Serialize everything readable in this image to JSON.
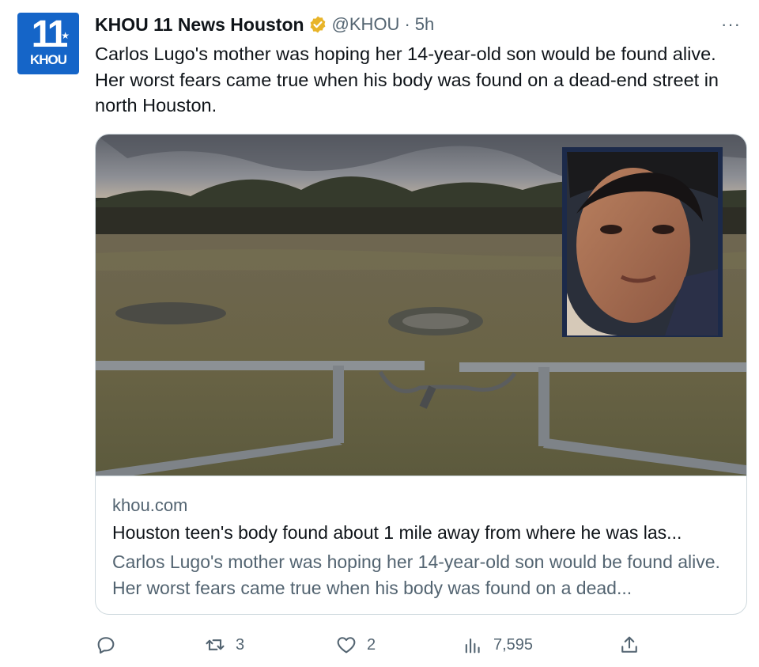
{
  "account": {
    "avatar_number": "11",
    "avatar_brand": "KHOU",
    "display_name": "KHOU 11 News Houston",
    "handle": "@KHOU",
    "separator": "·",
    "time": "5h",
    "more_label": "···",
    "verified_badge_icon": "gold-verified-badge-icon"
  },
  "tweet": {
    "text": "Carlos Lugo's mother was hoping her 14-year-old son would be found alive. Her worst fears came true when his body was found on a dead-end street in north Houston."
  },
  "card": {
    "domain": "khou.com",
    "title": "Houston teen's body found about 1 mile away from where he was las...",
    "description": "Carlos Lugo's mother was hoping her 14-year-old son would be found alive. Her worst fears came true when his body was found on a dead..."
  },
  "actions": {
    "reply_icon": "reply-icon",
    "retweet_icon": "retweet-icon",
    "retweet_count": "3",
    "like_icon": "heart-icon",
    "like_count": "2",
    "views_icon": "views-icon",
    "views_count": "7,595",
    "share_icon": "share-icon"
  },
  "colors": {
    "text_primary": "#0f1419",
    "text_secondary": "#536471",
    "border": "#cfd9de",
    "brand_blue": "#1565c8",
    "verified_gold": "#e8b429"
  }
}
